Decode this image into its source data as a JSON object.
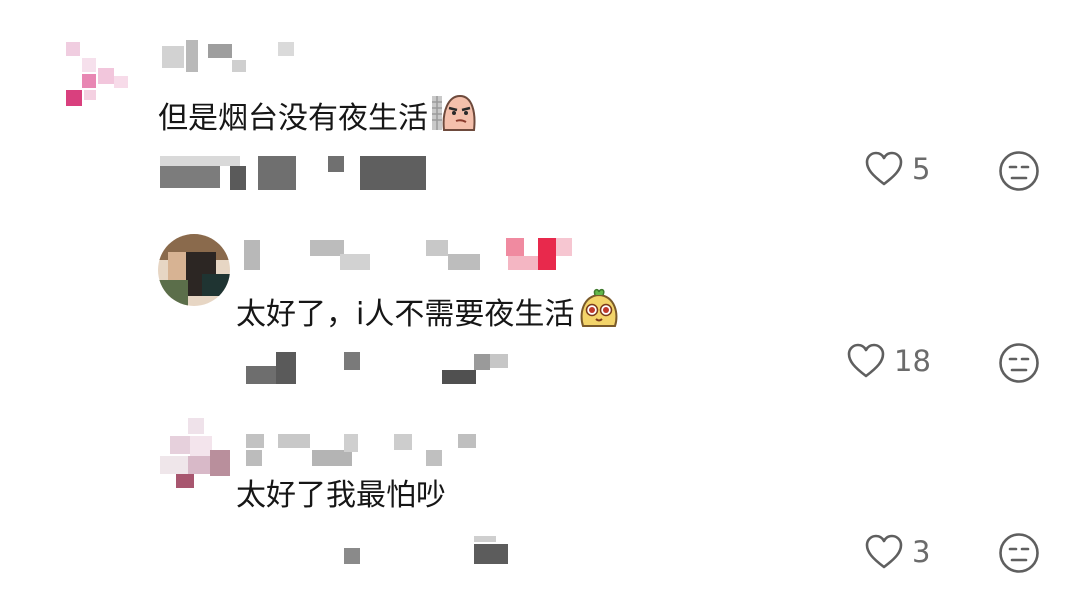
{
  "comments": [
    {
      "text": "但是烟台没有夜生活",
      "emoji": "smirk-sticker",
      "likes": "5"
    },
    {
      "text": "太好了，i人不需要夜生活",
      "emoji": "pudding-face-sticker",
      "likes": "18"
    },
    {
      "text": "太好了我最怕吵",
      "likes": "3"
    }
  ],
  "icons": {
    "like": "heart-outline-icon",
    "dislike": "expressionless-face-icon"
  },
  "colors": {
    "text": "#161616",
    "muted": "#6b6b6b",
    "icon": "#5f5f5f"
  }
}
